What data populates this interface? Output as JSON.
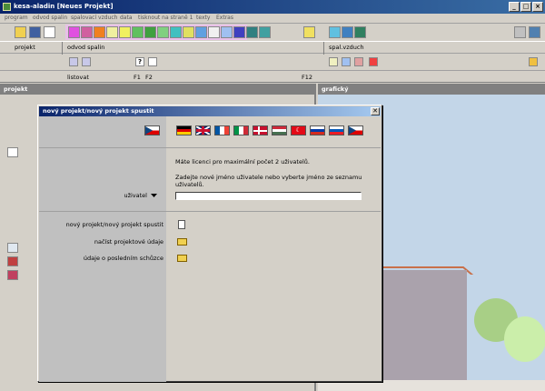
{
  "window": {
    "title": "kesa-aladin [Neues Projekt]"
  },
  "menu": [
    "program",
    "odvod spalin",
    "spalovací vzduch",
    "data",
    "tisknout na straně 1",
    "texty",
    "Extras"
  ],
  "labels": {
    "projekt": "projekt",
    "odvod_spalin": "odvod spalin",
    "spal_vzduch": "spal.vzduch",
    "listovat": "listovat",
    "f1": "F1",
    "f2": "F2",
    "f12": "F12",
    "question": "?"
  },
  "panels": {
    "left_title": "projekt",
    "right_title": "grafický"
  },
  "dialog": {
    "title": "nový projekt/nový projekt spustit",
    "close": "✕",
    "license": "Máte licenci pro maximální počet 2 uživatelů.",
    "instruction": "Zadejte nové jméno uživatele nebo vyberte jméno ze seznamu uživatelů.",
    "user_label": "uživatel",
    "user_value": "",
    "actions": [
      {
        "label": "nový projekt/nový projekt spustit"
      },
      {
        "label": "načíst projektové údaje"
      },
      {
        "label": "údaje o posledním schůzce"
      }
    ]
  },
  "flags": [
    "czech-flag",
    "german-flag",
    "uk-flag",
    "french-flag",
    "italian-flag",
    "danish-flag",
    "hungarian-flag",
    "turkish-flag",
    "russian-flag",
    "slovenian-flag",
    "czech-flag-2"
  ],
  "colors": {
    "titlebar": "#0a246a",
    "panel_bg": "#d4d0c8",
    "sky": "#c3d6e8",
    "wall": "#aaa2ac",
    "tree": "#a8cf86"
  }
}
